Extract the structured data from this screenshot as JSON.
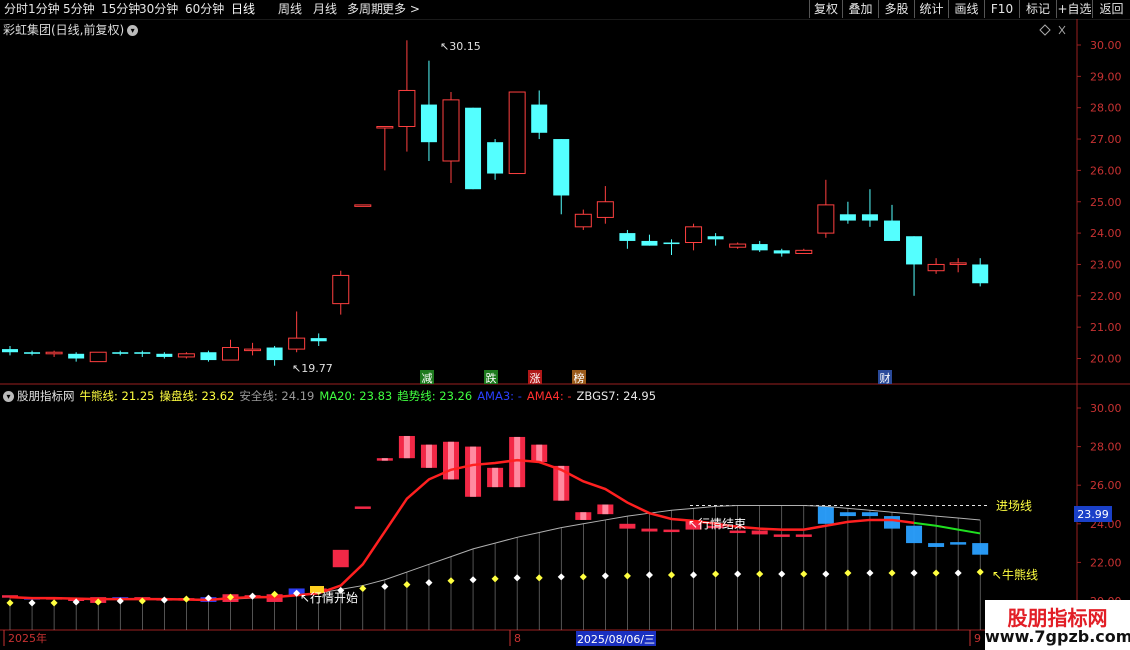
{
  "toolbar": {
    "periods": [
      "分时",
      "1分钟",
      "5分钟",
      "15分钟",
      "30分钟",
      "60分钟",
      "日线",
      "周线",
      "月线",
      "多周期",
      "更多 >"
    ],
    "active_period": "日线",
    "buttons": [
      "复权",
      "叠加",
      "多股",
      "统计",
      "画线",
      "F10",
      "标记",
      "+自选",
      "返回"
    ]
  },
  "stock": {
    "title": "彩虹集团(日线,前复权)",
    "high_label": "30.15",
    "low_label": "19.77"
  },
  "upper_axis": [
    "30.00",
    "29.00",
    "28.00",
    "27.00",
    "26.00",
    "25.00",
    "24.00",
    "23.00",
    "22.00",
    "21.00",
    "20.00"
  ],
  "lower_axis": [
    "30.00",
    "28.00",
    "26.00",
    "24.00",
    "22.00",
    "20.00"
  ],
  "current_price": "23.99",
  "markers": [
    {
      "text": "减",
      "color": "#1e7a1e"
    },
    {
      "text": "跌",
      "color": "#1e7a1e"
    },
    {
      "text": "涨",
      "color": "#b01818"
    },
    {
      "text": "榜",
      "color": "#9a5a1a"
    },
    {
      "text": "财",
      "color": "#2a4a9a"
    }
  ],
  "indicator": {
    "name": "股朋指标网",
    "items": [
      {
        "label": "牛熊线: 21.25",
        "color": "#ffff40"
      },
      {
        "label": "操盘线: 23.62",
        "color": "#ffff40"
      },
      {
        "label": "安全线: 24.19",
        "color": "#9a9a9a"
      },
      {
        "label": "MA20: 23.83",
        "color": "#40ff40"
      },
      {
        "label": "趋势线: 23.26",
        "color": "#40ff40"
      },
      {
        "label": "AMA3: -",
        "color": "#2a40ff"
      },
      {
        "label": "AMA4: -",
        "color": "#ff3030"
      },
      {
        "label": "ZBGS7: 24.95",
        "color": "#e8e8e8"
      }
    ]
  },
  "annotations": {
    "market_start": "行情开始",
    "market_end": "行情结束",
    "entry_line": "进场线",
    "bull_bear_line": "牛熊线"
  },
  "date_bar": {
    "year": "2025年",
    "month8": "8",
    "selected_date": "2025/08/06/三",
    "month9": "9"
  },
  "watermark": {
    "line1": "股朋指标网",
    "line2": "www.7gpzb.com"
  },
  "chart_data": [
    {
      "type": "candlestick",
      "title": "彩虹集团(日线,前复权)",
      "ylim": [
        19.6,
        30.4
      ],
      "candles": [
        {
          "o": 20.3,
          "h": 20.4,
          "l": 20.1,
          "c": 20.2
        },
        {
          "o": 20.2,
          "h": 20.25,
          "l": 20.1,
          "c": 20.15
        },
        {
          "o": 20.15,
          "h": 20.25,
          "l": 20.05,
          "c": 20.2
        },
        {
          "o": 20.15,
          "h": 20.2,
          "l": 19.9,
          "c": 20.0
        },
        {
          "o": 19.9,
          "h": 20.2,
          "l": 19.9,
          "c": 20.2
        },
        {
          "o": 20.2,
          "h": 20.25,
          "l": 20.1,
          "c": 20.15
        },
        {
          "o": 20.2,
          "h": 20.25,
          "l": 20.05,
          "c": 20.15
        },
        {
          "o": 20.15,
          "h": 20.2,
          "l": 20.0,
          "c": 20.05
        },
        {
          "o": 20.05,
          "h": 20.2,
          "l": 20.0,
          "c": 20.15
        },
        {
          "o": 20.2,
          "h": 20.25,
          "l": 19.9,
          "c": 19.95
        },
        {
          "o": 19.95,
          "h": 20.6,
          "l": 19.95,
          "c": 20.35
        },
        {
          "o": 20.3,
          "h": 20.5,
          "l": 20.1,
          "c": 20.3
        },
        {
          "o": 20.35,
          "h": 20.4,
          "l": 19.77,
          "c": 19.95
        },
        {
          "o": 20.3,
          "h": 21.5,
          "l": 20.2,
          "c": 20.65
        },
        {
          "o": 20.65,
          "h": 20.8,
          "l": 20.4,
          "c": 20.55
        },
        {
          "o": 21.75,
          "h": 22.8,
          "l": 21.4,
          "c": 22.65
        },
        {
          "o": 24.9,
          "h": 24.9,
          "l": 24.9,
          "c": 24.9
        },
        {
          "o": 27.4,
          "h": 27.4,
          "l": 26.0,
          "c": 27.4
        },
        {
          "o": 27.4,
          "h": 30.15,
          "l": 26.6,
          "c": 28.55
        },
        {
          "o": 28.1,
          "h": 29.5,
          "l": 26.3,
          "c": 26.9
        },
        {
          "o": 26.3,
          "h": 28.5,
          "l": 25.6,
          "c": 28.25
        },
        {
          "o": 28.0,
          "h": 28.0,
          "l": 25.4,
          "c": 25.4
        },
        {
          "o": 26.9,
          "h": 27.0,
          "l": 25.7,
          "c": 25.9
        },
        {
          "o": 25.9,
          "h": 28.5,
          "l": 25.9,
          "c": 28.5
        },
        {
          "o": 28.1,
          "h": 28.55,
          "l": 27.0,
          "c": 27.2
        },
        {
          "o": 27.0,
          "h": 27.0,
          "l": 24.6,
          "c": 25.2
        },
        {
          "o": 24.2,
          "h": 24.75,
          "l": 24.1,
          "c": 24.6
        },
        {
          "o": 24.5,
          "h": 25.5,
          "l": 24.3,
          "c": 25.0
        },
        {
          "o": 24.0,
          "h": 24.1,
          "l": 23.5,
          "c": 23.75
        },
        {
          "o": 23.75,
          "h": 23.95,
          "l": 23.6,
          "c": 23.6
        },
        {
          "o": 23.7,
          "h": 23.8,
          "l": 23.3,
          "c": 23.65
        },
        {
          "o": 23.7,
          "h": 24.3,
          "l": 23.45,
          "c": 24.2
        },
        {
          "o": 23.9,
          "h": 24.0,
          "l": 23.6,
          "c": 23.8
        },
        {
          "o": 23.55,
          "h": 23.7,
          "l": 23.5,
          "c": 23.65
        },
        {
          "o": 23.65,
          "h": 23.75,
          "l": 23.4,
          "c": 23.45
        },
        {
          "o": 23.45,
          "h": 23.5,
          "l": 23.25,
          "c": 23.35
        },
        {
          "o": 23.35,
          "h": 23.5,
          "l": 23.35,
          "c": 23.45
        },
        {
          "o": 24.0,
          "h": 25.7,
          "l": 23.85,
          "c": 24.9
        },
        {
          "o": 24.6,
          "h": 25.0,
          "l": 24.3,
          "c": 24.4
        },
        {
          "o": 24.6,
          "h": 25.4,
          "l": 24.2,
          "c": 24.4
        },
        {
          "o": 24.4,
          "h": 24.9,
          "l": 23.75,
          "c": 23.75
        },
        {
          "o": 23.9,
          "h": 23.9,
          "l": 22.0,
          "c": 23.0
        },
        {
          "o": 22.8,
          "h": 23.2,
          "l": 22.7,
          "c": 23.0
        },
        {
          "o": 23.0,
          "h": 23.2,
          "l": 22.75,
          "c": 23.05
        },
        {
          "o": 23.0,
          "h": 23.2,
          "l": 22.3,
          "c": 22.4
        }
      ]
    },
    {
      "type": "line",
      "title": "股朋指标网",
      "ylim": [
        19.7,
        30.9
      ],
      "series": [
        {
          "name": "操盘线",
          "values": [
            20.2,
            20.15,
            20.15,
            20.12,
            20.1,
            20.1,
            20.1,
            20.1,
            20.08,
            20.05,
            20.15,
            20.2,
            20.2,
            20.3,
            20.4,
            20.8,
            21.9,
            23.6,
            25.3,
            26.3,
            26.8,
            27.05,
            27.15,
            27.3,
            27.2,
            26.8,
            26.2,
            25.8,
            25.1,
            24.55,
            24.25,
            24.15,
            24.0,
            23.85,
            23.75,
            23.7,
            23.7,
            23.9,
            24.1,
            24.2,
            24.2,
            24.05,
            23.9,
            23.7,
            23.5
          ]
        },
        {
          "name": "趋势线",
          "values": [
            20.2,
            20.15,
            20.15,
            20.1,
            20.1,
            20.1,
            20.1,
            20.1,
            20.1,
            20.1,
            20.1,
            20.15,
            20.2,
            20.3,
            20.4,
            20.6,
            20.8,
            21.1,
            21.5,
            21.9,
            22.3,
            22.7,
            23.0,
            23.3,
            23.55,
            23.8,
            24.0,
            24.2,
            24.4,
            24.55,
            24.7,
            24.8,
            24.9,
            24.95,
            24.95,
            24.95,
            24.95,
            24.9,
            24.8,
            24.7,
            24.6,
            24.5,
            24.4,
            24.3,
            24.2
          ]
        },
        {
          "name": "牛熊线",
          "values": [
            19.9,
            19.9,
            19.9,
            19.95,
            19.95,
            20.0,
            20.0,
            20.05,
            20.1,
            20.15,
            20.2,
            20.25,
            20.35,
            20.4,
            20.5,
            20.55,
            20.65,
            20.75,
            20.85,
            20.95,
            21.05,
            21.1,
            21.15,
            21.2,
            21.2,
            21.25,
            21.25,
            21.3,
            21.3,
            21.35,
            21.35,
            21.35,
            21.4,
            21.4,
            21.4,
            21.4,
            21.4,
            21.4,
            21.45,
            21.45,
            21.45,
            21.45,
            21.45,
            21.45,
            21.5
          ]
        }
      ],
      "entry_line": 24.95
    }
  ]
}
